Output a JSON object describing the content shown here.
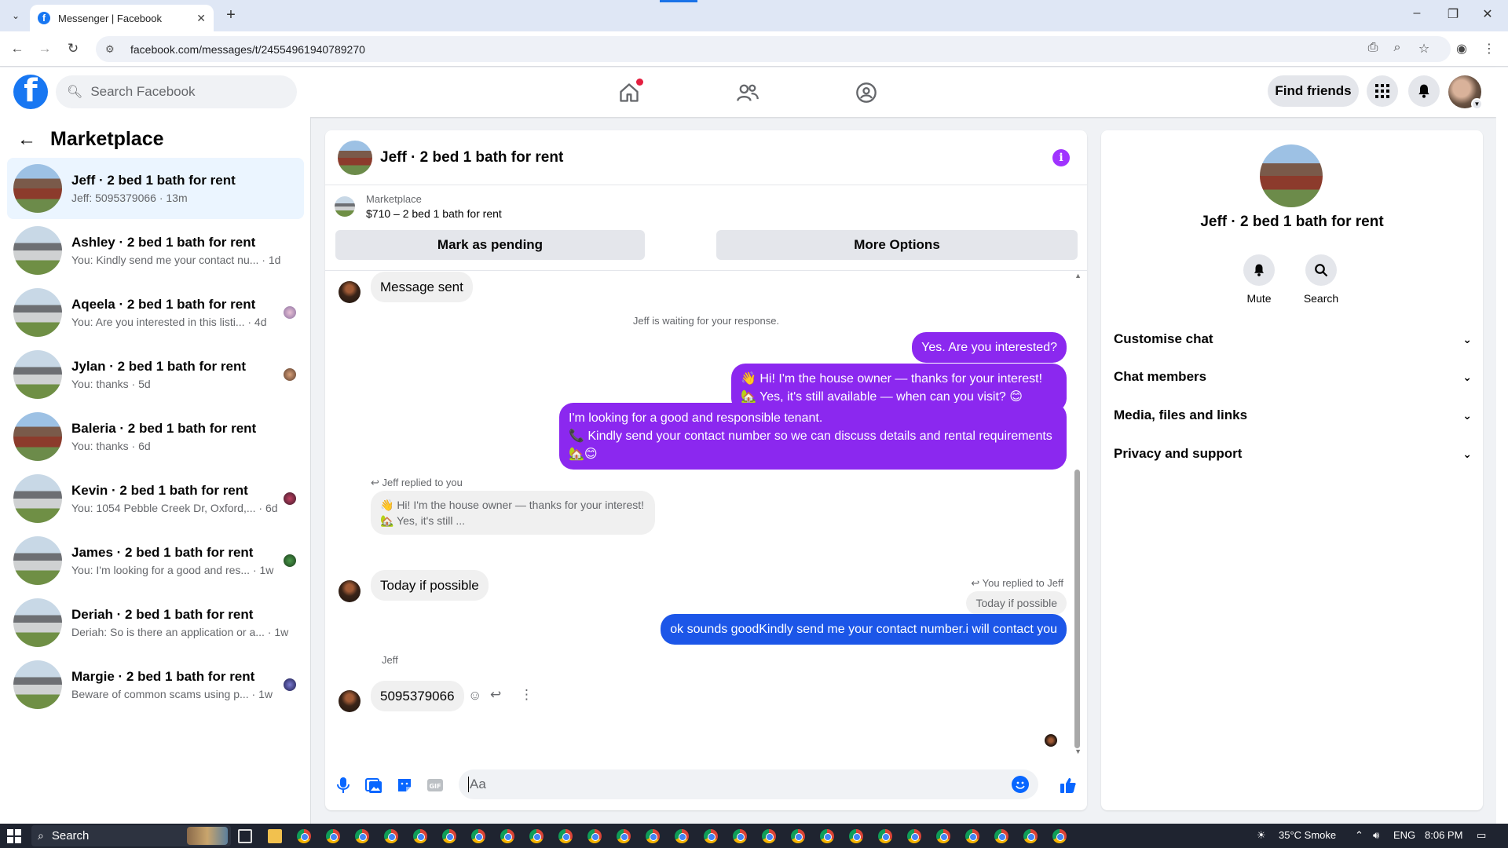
{
  "browser": {
    "tab_title": "Messenger | Facebook",
    "url": "facebook.com/messages/t/24554961940789270"
  },
  "header": {
    "search_placeholder": "Search Facebook",
    "find_friends": "Find friends"
  },
  "sidebar": {
    "title": "Marketplace",
    "conversations": [
      {
        "name": "Jeff · 2 bed 1 bath for rent",
        "preview": "Jeff: 5095379066 · 13m",
        "active": true
      },
      {
        "name": "Ashley · 2 bed 1 bath for rent",
        "preview": "You: Kindly send me your contact nu... · 1d"
      },
      {
        "name": "Aqeela · 2 bed 1 bath for rent",
        "preview": "You: Are you interested in this listi... · 4d"
      },
      {
        "name": "Jylan · 2 bed 1 bath for rent",
        "preview": "You: thanks · 5d"
      },
      {
        "name": "Baleria · 2 bed 1 bath for rent",
        "preview": "You: thanks · 6d"
      },
      {
        "name": "Kevin · 2 bed 1 bath for rent",
        "preview": "You: 1054 Pebble Creek Dr, Oxford,... · 6d"
      },
      {
        "name": "James · 2 bed 1 bath for rent",
        "preview": "You: I'm looking for a good and res... · 1w"
      },
      {
        "name": "Deriah · 2 bed 1 bath for rent",
        "preview": "Deriah: So is there an application or a... · 1w"
      },
      {
        "name": "Margie · 2 bed 1 bath for rent",
        "preview": "Beware of common scams using p... · 1w"
      }
    ]
  },
  "chat": {
    "title": "Jeff · 2 bed 1 bath for rent",
    "listing_label": "Marketplace",
    "listing_detail": "$710 – 2 bed 1 bath for rent",
    "mark_pending": "Mark as pending",
    "more_options": "More Options",
    "msg_sent": "Message sent",
    "waiting": "Jeff is waiting for your response.",
    "out1": "Yes. Are you interested?",
    "out2_line1": "👋 Hi! I'm the house owner — thanks for your interest!",
    "out2_line2": "🏡 Yes, it's still available — when can you visit? 😊",
    "out3_line1": "I'm looking for a good and responsible tenant.",
    "out3_line2": "📞 Kindly send your contact number so we can discuss details and rental requirements 🏡😊",
    "jeff_replied": "Jeff replied to you",
    "quoted_line1": "👋 Hi! I'm the house owner — thanks for your interest!",
    "quoted_line2": "🏡 Yes, it's still ...",
    "in_today": "Today if possible",
    "you_replied": "You replied to Jeff",
    "quoted_today": "Today if possible",
    "out4": "ok sounds goodKindly send me your contact number.i will contact you",
    "sender_label": "Jeff",
    "in_number": "5095379066",
    "composer_placeholder": "Aa"
  },
  "right_panel": {
    "name": "Jeff · 2 bed 1 bath for rent",
    "mute": "Mute",
    "search": "Search",
    "rows": [
      "Customise chat",
      "Chat members",
      "Media, files and links",
      "Privacy and support"
    ]
  },
  "taskbar": {
    "search": "Search",
    "weather": "35°C  Smoke",
    "lang": "ENG",
    "time": "8:06 PM"
  },
  "colors": {
    "fb_blue": "#1877f2",
    "outgoing_purple": "#8b28ef",
    "outgoing_blue": "#1c56e8",
    "active_conv": "#ebf5ff"
  }
}
